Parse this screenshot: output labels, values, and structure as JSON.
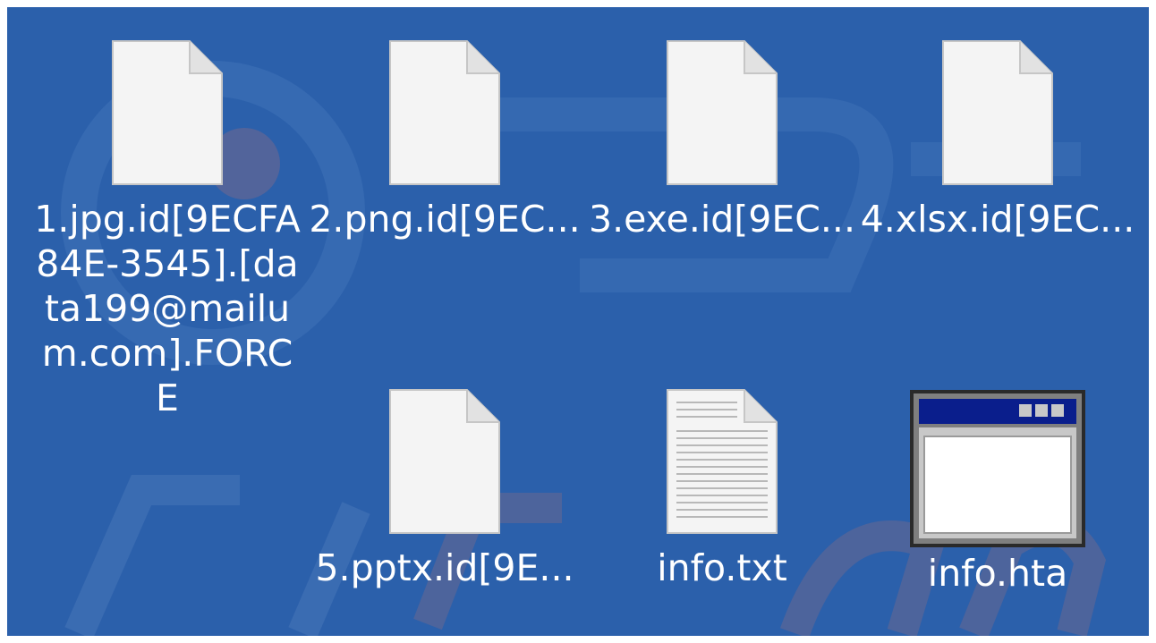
{
  "desktop": {
    "background_color": "#2b60ab",
    "files": [
      {
        "name": "1.jpg.id[9ECFA84E-3545].[data199@mailum.com].FORCE",
        "lines": [
          "1.jpg.id[9ECFA",
          "84E-3545].[da",
          "ta199@mailu",
          "m.com].FORC",
          "E"
        ],
        "icon": "blank-document-icon",
        "selected": true
      },
      {
        "name": "2.png.id[9EC...",
        "icon": "blank-document-icon"
      },
      {
        "name": "3.exe.id[9EC...",
        "icon": "blank-document-icon"
      },
      {
        "name": "4.xlsx.id[9EC...",
        "icon": "blank-document-icon"
      },
      {
        "name": "5.pptx.id[9E...",
        "icon": "blank-document-icon"
      },
      {
        "name": "info.txt",
        "icon": "text-document-icon"
      },
      {
        "name": "info.hta",
        "icon": "hta-application-icon"
      }
    ]
  }
}
